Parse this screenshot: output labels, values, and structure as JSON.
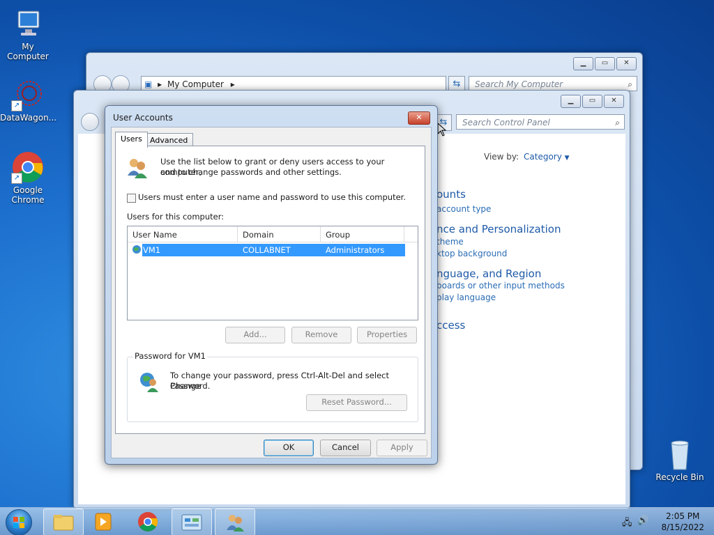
{
  "desktop": {
    "icons": [
      {
        "label": "My Computer"
      },
      {
        "label": "DataWagon..."
      },
      {
        "label": "Google Chrome"
      },
      {
        "label": "Recycle Bin"
      }
    ]
  },
  "explorer_window": {
    "address": "My Computer",
    "search_placeholder": "Search My Computer"
  },
  "control_panel_window": {
    "search_placeholder": "Search Control Panel",
    "view_by_label": "View by:",
    "view_by_value": "Category",
    "categories": [
      {
        "title": "ounts",
        "links": [
          "account type"
        ]
      },
      {
        "title": "nce and Personalization",
        "links": [
          "theme",
          "ktop background"
        ]
      },
      {
        "title": "nguage, and Region",
        "links": [
          "boards or other input methods",
          "play language"
        ]
      },
      {
        "title": "ccess",
        "links": []
      }
    ]
  },
  "dialog": {
    "title": "User Accounts",
    "close_glyph": "✕",
    "tabs": [
      {
        "label": "Users",
        "active": true
      },
      {
        "label": "Advanced",
        "active": false
      }
    ],
    "intro_line1": "Use the list below to grant or deny users access to your computer,",
    "intro_line2": "and to change passwords and other settings.",
    "checkbox_label": "Users must enter a user name and password to use this computer.",
    "checkbox_checked": false,
    "users_label": "Users for this computer:",
    "columns": [
      "User Name",
      "Domain",
      "Group"
    ],
    "rows": [
      {
        "user": "VM1",
        "domain": "COLLABNET",
        "group": "Administrators",
        "selected": true
      }
    ],
    "buttons": {
      "add": "Add...",
      "remove": "Remove",
      "properties": "Properties"
    },
    "password_group_title": "Password for VM1",
    "password_text_line1": "To change your password, press Ctrl-Alt-Del and select Change",
    "password_text_line2": "Password.",
    "reset_password": "Reset Password...",
    "ok": "OK",
    "cancel": "Cancel",
    "apply": "Apply"
  },
  "taskbar": {
    "time": "2:05 PM",
    "date": "8/15/2022"
  }
}
